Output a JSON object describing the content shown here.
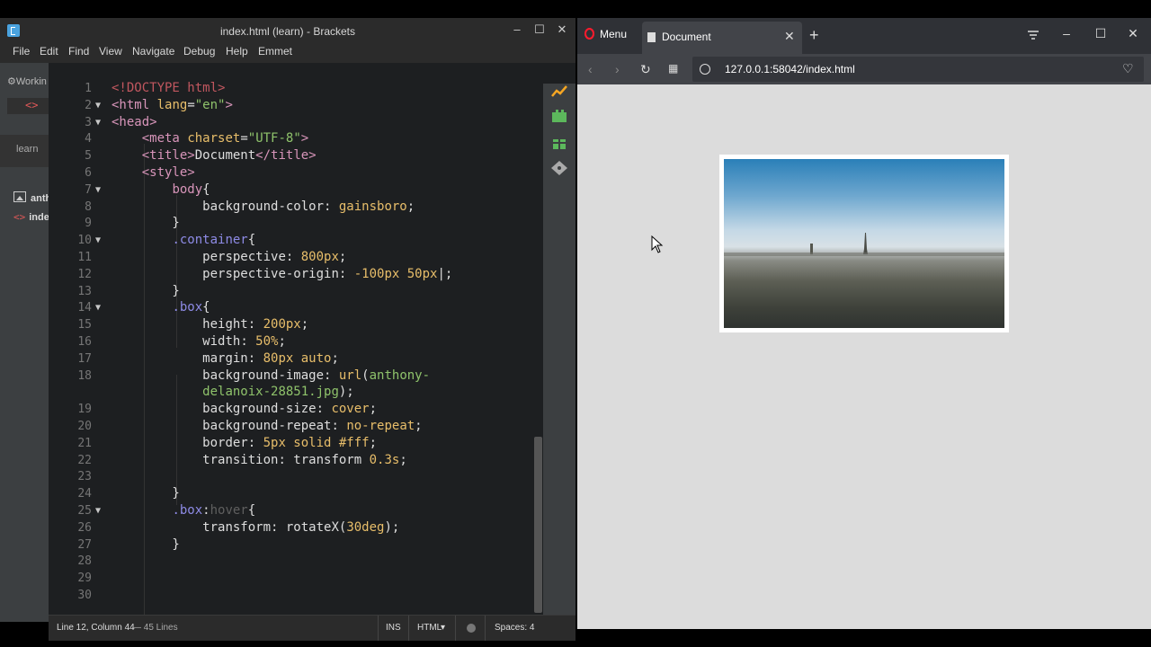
{
  "brackets": {
    "title": "index.html (learn) - Brackets",
    "window_buttons": [
      "–",
      "☐",
      "✕"
    ],
    "menu": [
      "File",
      "Edit",
      "Find",
      "View",
      "Navigate",
      "Debug",
      "Help",
      "Emmet"
    ],
    "sidebar": {
      "working_files_label": "Workin",
      "working_active_icon": "<>",
      "project_label": "learn",
      "files": [
        {
          "icon": "image-file-icon",
          "name": "anth"
        },
        {
          "icon": "code-file-icon",
          "name": "inde"
        }
      ]
    },
    "code_lines": [
      {
        "n": "1",
        "fold": false,
        "html": "<span class='cm'>&lt;!DOCTYPE html&gt;</span>"
      },
      {
        "n": "2",
        "fold": true,
        "html": "<span class='tg'>&lt;html</span> <span class='at'>lang</span>=<span class='st'>\"en\"</span><span class='tg'>&gt;</span>"
      },
      {
        "n": "3",
        "fold": true,
        "html": "<span class='tg'>&lt;head&gt;</span>"
      },
      {
        "n": "4",
        "fold": false,
        "html": "    <span class='tg'>&lt;meta</span> <span class='at'>charset</span>=<span class='st'>\"UTF-8\"</span><span class='tg'>&gt;</span>"
      },
      {
        "n": "5",
        "fold": false,
        "html": "    <span class='tg'>&lt;title&gt;</span>Document<span class='tg'>&lt;/title&gt;</span>"
      },
      {
        "n": "6",
        "fold": false,
        "html": "    <span class='tg'>&lt;style&gt;</span>"
      },
      {
        "n": "7",
        "fold": true,
        "html": "        <span class='tg'>body</span>{"
      },
      {
        "n": "8",
        "fold": false,
        "html": "            <span class='pr'>background-color</span>: <span class='vl'>gainsboro</span>;"
      },
      {
        "n": "9",
        "fold": false,
        "html": "        }"
      },
      {
        "n": "10",
        "fold": true,
        "html": "        <span class='sl'>.container</span>{"
      },
      {
        "n": "11",
        "fold": false,
        "html": "            <span class='pr'>perspective</span>: <span class='vl'>800px</span>;"
      },
      {
        "n": "12",
        "fold": false,
        "html": "            <span class='pr'>perspective-origin</span>: <span class='vl'>-100px 50px</span>|;"
      },
      {
        "n": "13",
        "fold": false,
        "html": "        }"
      },
      {
        "n": "14",
        "fold": true,
        "html": "        <span class='sl'>.box</span>{"
      },
      {
        "n": "15",
        "fold": false,
        "html": "            <span class='pr'>height</span>: <span class='vl'>200px</span>;"
      },
      {
        "n": "16",
        "fold": false,
        "html": "            <span class='pr'>width</span>: <span class='vl'>50%</span>;"
      },
      {
        "n": "17",
        "fold": false,
        "html": "            <span class='pr'>margin</span>: <span class='vl'>80px auto</span>;"
      },
      {
        "n": "18",
        "fold": false,
        "html": "            <span class='pr'>background-image</span>: <span class='vl'>url</span>(<span class='st'>anthony-</span>"
      },
      {
        "n": "",
        "fold": false,
        "html": "            <span class='st'>delanoix-28851.jpg</span>);"
      },
      {
        "n": "19",
        "fold": false,
        "html": "            <span class='pr'>background-size</span>: <span class='vl'>cover</span>;"
      },
      {
        "n": "20",
        "fold": false,
        "html": "            <span class='pr'>background-repeat</span>: <span class='vl'>no-repeat</span>;"
      },
      {
        "n": "21",
        "fold": false,
        "html": "            <span class='pr'>border</span>: <span class='vl'>5px solid #fff</span>;"
      },
      {
        "n": "22",
        "fold": false,
        "html": "            <span class='pr'>transition</span>: transform <span class='vl'>0.3s</span>;"
      },
      {
        "n": "23",
        "fold": false,
        "html": ""
      },
      {
        "n": "24",
        "fold": false,
        "html": "        }"
      },
      {
        "n": "25",
        "fold": true,
        "html": "        <span class='sl'>.box</span>:<span class='ps'>hover</span>{"
      },
      {
        "n": "26",
        "fold": false,
        "html": "            <span class='pr'>transform</span>: rotateX(<span class='vl'>30deg</span>);"
      },
      {
        "n": "27",
        "fold": false,
        "html": "        }"
      },
      {
        "n": "28",
        "fold": false,
        "html": ""
      },
      {
        "n": "29",
        "fold": false,
        "html": ""
      },
      {
        "n": "30",
        "fold": false,
        "html": ""
      }
    ],
    "status": {
      "position": "Line 12, Column 44",
      "lines": "— 45 Lines",
      "mode": "INS",
      "language": "HTML",
      "language_arrow": "▾",
      "spaces": "Spaces: 4"
    }
  },
  "browser": {
    "menu_label": "Menu",
    "tab_title": "Document",
    "tab_close": "✕",
    "new_tab": "+",
    "url": "127.0.0.1:58042/index.html",
    "window_buttons": [
      "–",
      "☐",
      "✕"
    ],
    "page_background": "#dcdcdc"
  },
  "colors": {
    "editor_bg": "#1d1f21",
    "accent_red": "#e05858",
    "opera_red": "#ff1b2d"
  }
}
